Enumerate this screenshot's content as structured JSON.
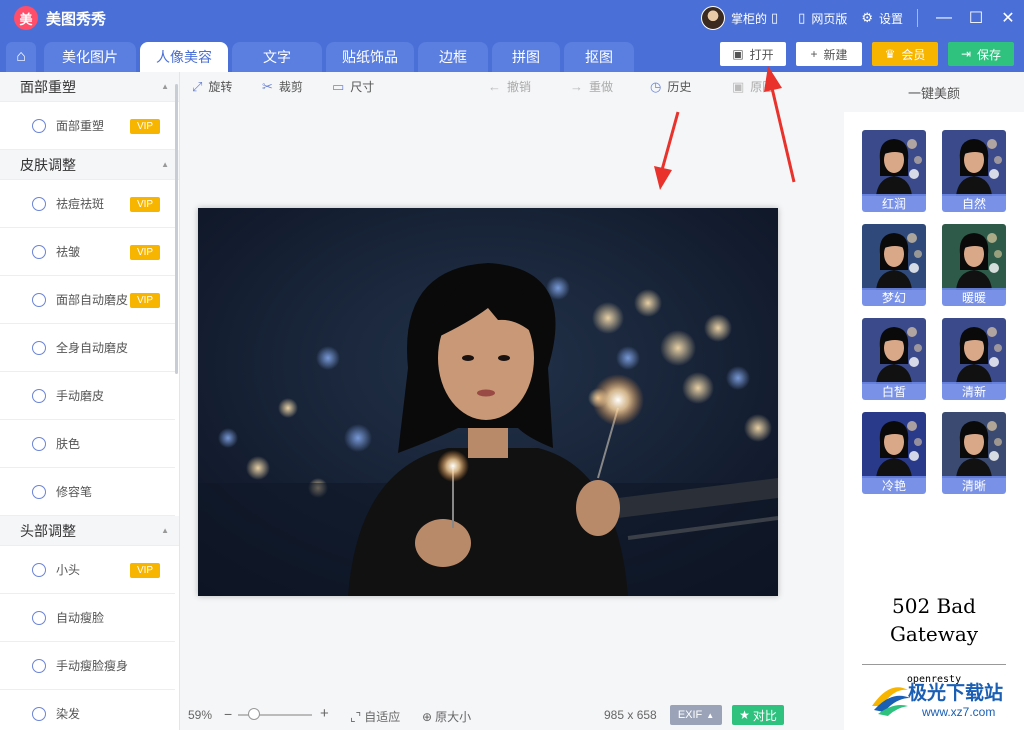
{
  "app": {
    "title": "美图秀秀",
    "logo_glyph": "美"
  },
  "titlebar": {
    "user_name": "掌柜的",
    "web_label": "网页版",
    "settings_label": "设置"
  },
  "tabs": [
    {
      "label": "美化图片"
    },
    {
      "label": "人像美容"
    },
    {
      "label": "文字"
    },
    {
      "label": "贴纸饰品"
    },
    {
      "label": "边框"
    },
    {
      "label": "拼图"
    },
    {
      "label": "抠图"
    }
  ],
  "header_buttons": {
    "open": "打开",
    "new": "新建",
    "vip": "会员",
    "save": "保存"
  },
  "sidebar": {
    "sections": [
      {
        "title": "面部重塑",
        "items": [
          {
            "label": "面部重塑",
            "vip": "VIP"
          }
        ]
      },
      {
        "title": "皮肤调整",
        "items": [
          {
            "label": "祛痘祛斑",
            "vip": "VIP"
          },
          {
            "label": "祛皱",
            "vip": "VIP"
          },
          {
            "label": "面部自动磨皮",
            "vip": "VIP"
          },
          {
            "label": "全身自动磨皮"
          },
          {
            "label": "手动磨皮"
          },
          {
            "label": "肤色"
          },
          {
            "label": "修容笔"
          }
        ]
      },
      {
        "title": "头部调整",
        "items": [
          {
            "label": "小头",
            "vip": "VIP"
          },
          {
            "label": "自动瘦脸"
          },
          {
            "label": "手动瘦脸瘦身"
          },
          {
            "label": "染发"
          }
        ]
      }
    ]
  },
  "edit_toolbar": {
    "rotate": "旋转",
    "crop": "裁剪",
    "size": "尺寸",
    "undo": "撤销",
    "redo": "重做",
    "history": "历史",
    "original": "原图"
  },
  "bottom": {
    "zoom": "59%",
    "fit": "自适应",
    "original_size": "原大小",
    "dimensions": "985 x 658",
    "exif": "EXIF",
    "compare": "对比"
  },
  "right_panel": {
    "title": "一键美颜",
    "presets": [
      {
        "label": "红润"
      },
      {
        "label": "自然"
      },
      {
        "label": "梦幻"
      },
      {
        "label": "暖暖"
      },
      {
        "label": "白皙"
      },
      {
        "label": "清新"
      },
      {
        "label": "冷艳"
      },
      {
        "label": "清晰"
      }
    ],
    "error_line1": "502 Bad",
    "error_line2": "Gateway",
    "error_server": "openresty"
  },
  "watermark": {
    "line1": "极光下载站",
    "line2": "www.xz7.com"
  },
  "colors": {
    "brand": "#4a6fd6",
    "vip": "#f7b500",
    "save": "#2ec27e",
    "arrow": "#e8322b"
  }
}
